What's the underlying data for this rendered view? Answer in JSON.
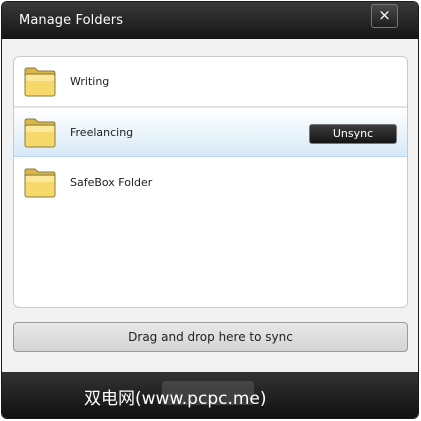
{
  "dialog": {
    "title": "Manage Folders",
    "close_label": "×"
  },
  "folders": [
    {
      "name": "Writing",
      "selected": false
    },
    {
      "name": "Freelancing",
      "selected": true,
      "action_label": "Unsync"
    },
    {
      "name": "SafeBox Folder",
      "selected": false
    }
  ],
  "drop_zone": {
    "label": "Drag and drop here to sync"
  },
  "watermark": {
    "text": "双电网(www.pcpc.me)"
  },
  "colors": {
    "titlebar": "#1f1f1f",
    "selected_row": "#d6e9f7",
    "folder_fill": "#f6d96a",
    "button_dark": "#222222"
  },
  "icons": {
    "folder": "folder-icon",
    "close": "close-icon"
  }
}
